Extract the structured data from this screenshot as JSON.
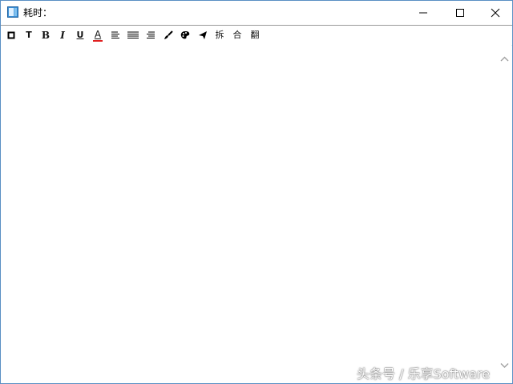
{
  "window": {
    "title": "耗时：",
    "icon": "notepad-icon"
  },
  "window_controls": {
    "minimize": "minimize-icon",
    "maximize": "maximize-icon",
    "close": "close-icon"
  },
  "toolbar": {
    "items": [
      {
        "icon": "border-box-icon"
      },
      {
        "icon": "text-t-icon",
        "glyph": "T"
      },
      {
        "icon": "bold-icon",
        "glyph": "B"
      },
      {
        "icon": "italic-icon",
        "glyph": "I"
      },
      {
        "icon": "underline-icon",
        "glyph": "U"
      },
      {
        "icon": "font-color-icon",
        "glyph": "A",
        "accent": "#e02020"
      },
      {
        "icon": "align-left-icon"
      },
      {
        "icon": "align-justify-icon"
      },
      {
        "icon": "align-right-icon"
      },
      {
        "icon": "brush-icon"
      },
      {
        "icon": "paint-palette-icon"
      },
      {
        "icon": "send-icon"
      },
      {
        "label": "拆"
      },
      {
        "label": "合"
      },
      {
        "label": "翻"
      }
    ]
  },
  "editor": {
    "content": ""
  },
  "watermark": "头条号 / 乐享Software"
}
